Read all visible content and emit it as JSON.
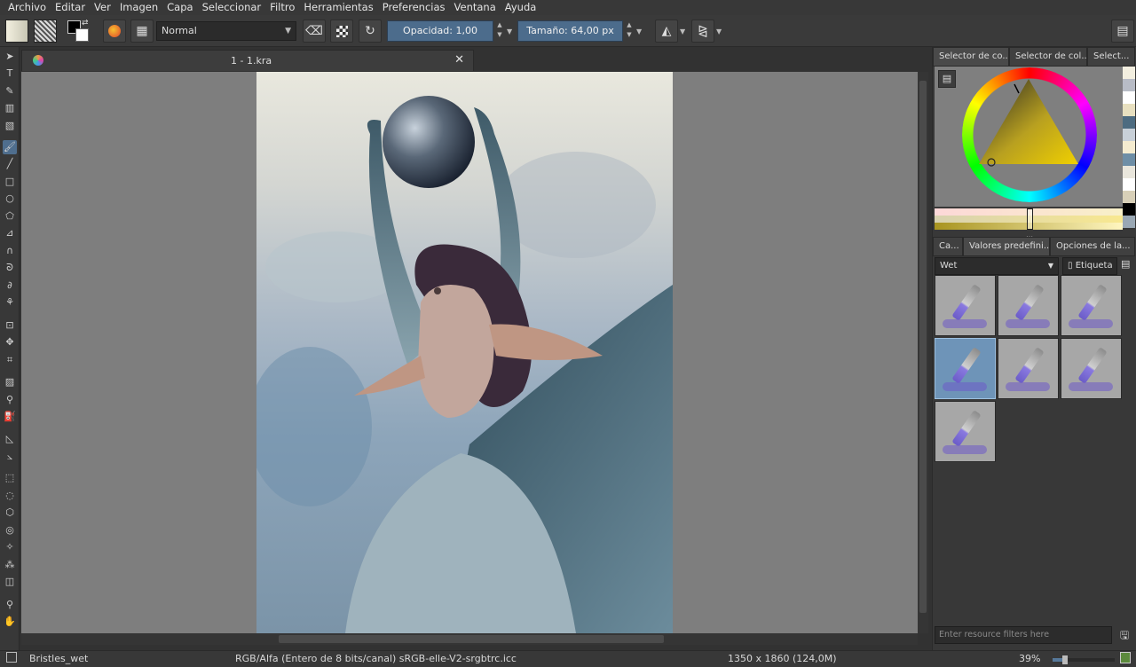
{
  "menu": [
    "Archivo",
    "Editar",
    "Ver",
    "Imagen",
    "Capa",
    "Seleccionar",
    "Filtro",
    "Herramientas",
    "Preferencias",
    "Ventana",
    "Ayuda"
  ],
  "options": {
    "blend_mode": "Normal",
    "opacity_label": "Opacidad:",
    "opacity_value": "1,00",
    "size_label": "Tamaño:",
    "size_value": "64,00 px"
  },
  "document": {
    "tab_title": "1 - 1.kra",
    "close_icon": "close-icon"
  },
  "docker": {
    "color_tabs": [
      "Selector de co...",
      "Selector de col...",
      "Select..."
    ],
    "color_palette": [
      "#f3efe0",
      "#b8bcc6",
      "#ffffff",
      "#e8e0c0",
      "#4d6b80",
      "#c8d0d8",
      "#f5ecd0",
      "#6e8ea6",
      "#e9e6dc",
      "#ffffff",
      "#d8d0b8",
      "#000000",
      "#9aa8b4"
    ],
    "preset_tabs": [
      "Ca...",
      "Valores predefini...",
      "Opciones de la..."
    ],
    "preset_filter": "Wet",
    "tag_label": "Etiqueta",
    "presets": [
      "Wet preset 1",
      "Wet preset 2",
      "Wet preset 3",
      "Wet preset 4",
      "Wet preset 5",
      "Wet preset 6",
      "Wet preset 7"
    ],
    "selected_preset_index": 3,
    "filter_placeholder": "Enter resource filters here"
  },
  "status": {
    "brush": "Bristles_wet",
    "color_space": "RGB/Alfa (Entero de 8 bits/canal)  sRGB-elle-V2-srgbtrc.icc",
    "dimensions": "1350 x 1860 (124,0M)",
    "zoom": "39%",
    "zoom_level": 0.39
  },
  "colors": {
    "accent": "#4c6c8c",
    "foreground": "#000000",
    "background": "#ffffff",
    "selected_triangle_hue": "#f0d000"
  }
}
